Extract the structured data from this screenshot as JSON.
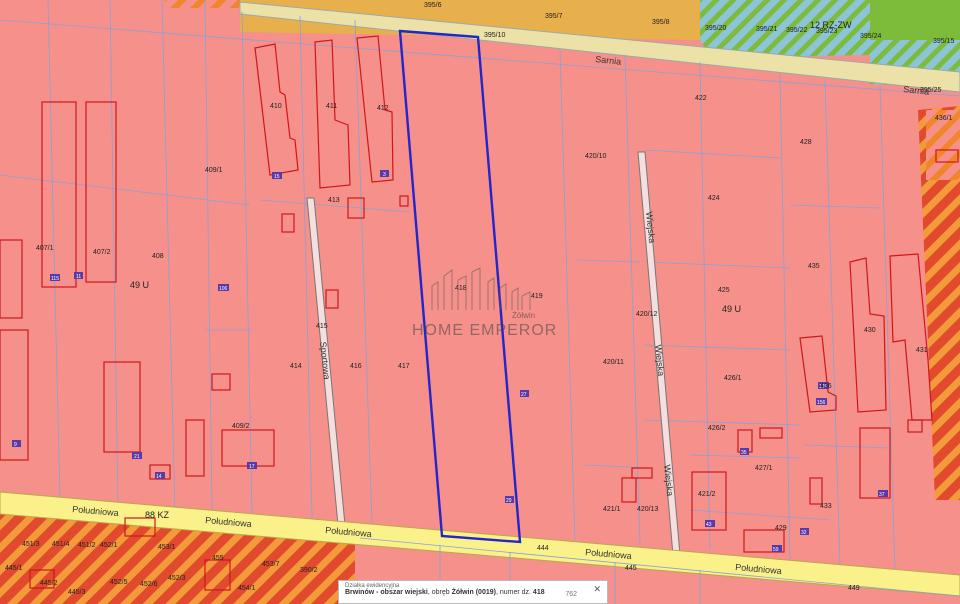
{
  "map": {
    "zone_labels": {
      "left_zone": "49 U",
      "right_zone": "49 U",
      "top_zone": "12 RZ-ZW",
      "bottom_zone": "88 KZ"
    },
    "streets": {
      "poludniowa": "Południowa",
      "sportowa": "Sportowa",
      "wiejska": "Wiejska",
      "sarna": "Sarnia"
    },
    "parcels": {
      "p395_6": "395/6",
      "p395_7": "395/7",
      "p395_8": "395/8",
      "p395_10": "395/10",
      "p395_20": "395/20",
      "p395_21": "395/21",
      "p395_22": "395/22",
      "p395_23": "395/23",
      "p395_24": "395/24",
      "p395_15": "395/15",
      "p395_25": "395/25",
      "p407_1": "407/1",
      "p407_2": "407/2",
      "p408": "408",
      "p409_1": "409/1",
      "p409_2": "409/2",
      "p410": "410",
      "p411": "411",
      "p412": "412",
      "p413": "413",
      "p414": "414",
      "p415": "415",
      "p416": "416",
      "p417": "417",
      "p418": "418",
      "p419": "419",
      "p420_10": "420/10",
      "p420_11": "420/11",
      "p420_12": "420/12",
      "p420_13": "420/13",
      "p421_1": "421/1",
      "p421_2": "421/2",
      "p422": "422",
      "p423": "423",
      "p424": "424",
      "p425": "425",
      "p426_1": "426/1",
      "p426_2": "426/2",
      "p427_1": "427/1",
      "p428": "428",
      "p429": "429",
      "p430": "430",
      "p431": "431",
      "p433": "433",
      "p435": "435",
      "p436": "436",
      "p444": "444",
      "p445": "445",
      "p449": "449",
      "p451_3": "451/3",
      "p451_4": "451/4",
      "p451_2": "451/2",
      "p452_1": "452/1",
      "p455": "455",
      "p445_1": "445/1",
      "p445_2": "445/2",
      "p445_3": "445/3",
      "p450_2": "450/2",
      "p451_1": "451/1",
      "p453_7": "453/7",
      "p452_5": "452/5",
      "p452_3": "452/3",
      "p452_6": "452/6",
      "p454_1": "454/1",
      "p456_2": "456/2",
      "p453_1": "453/1",
      "p390_2": "390/2",
      "p436_1": "436/1"
    },
    "building_numbers": {
      "b115": "115",
      "b11": "11",
      "b106": "106",
      "b15": "15",
      "b3": "3",
      "b17": "17",
      "b21": "21",
      "b27": "27",
      "b29": "29",
      "b14": "14",
      "b9": "9",
      "b43": "43",
      "b35": "35",
      "b37": "37",
      "b32": "32",
      "b59": "59",
      "b156": "156",
      "b126": "126"
    },
    "watermark": {
      "brand": "HOME EMPEROR",
      "sub": "Żółwin"
    }
  },
  "popup": {
    "title": "Działka ewidencyjna",
    "body_prefix": "Brwinów - obszar wiejski",
    "body_mid": ", obręb ",
    "obreb": "Żółwin (0019)",
    "body_suffix": ", numer dz.",
    "parcel_number": "418",
    "extra": "762",
    "close": "✕"
  },
  "colors": {
    "residential": "#f6908a",
    "services": "#e8b04c",
    "green": "#7dbb3a",
    "road": "#fbf18a",
    "selected": "#2326c9",
    "building": "#d0161a",
    "hatch": "#f0852a"
  }
}
